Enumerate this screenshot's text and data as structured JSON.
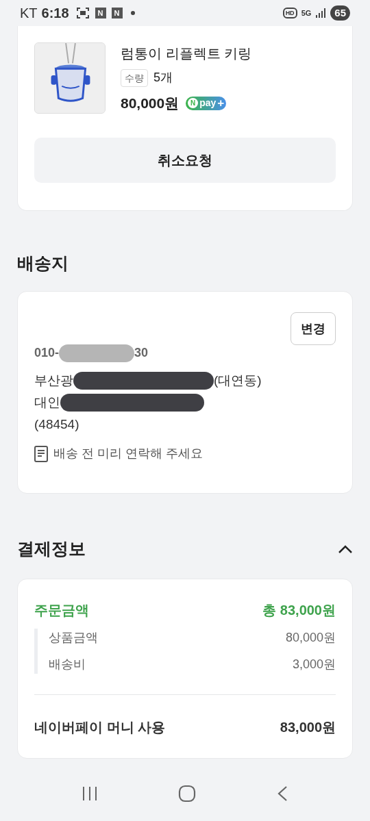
{
  "status_bar": {
    "carrier": "KT",
    "time": "6:18",
    "notification_letters": [
      "N",
      "N"
    ],
    "hd_badge": "HD",
    "network": "5G",
    "battery": "65"
  },
  "order_item": {
    "name": "럼통이 리플렉트 키링",
    "quantity_label": "수량",
    "quantity": "5개",
    "price": "80,000원",
    "pay_badge": {
      "logo": "N",
      "text": "pay",
      "plus": "+"
    },
    "cancel_button": "취소요청"
  },
  "shipping": {
    "title": "배송지",
    "change_button": "변경",
    "phone_parts": [
      "010-",
      "30"
    ],
    "address_lines": [
      {
        "text": "부산광",
        "redacted": true,
        "after": "(대연동)"
      },
      {
        "text": "대인",
        "redacted": true
      },
      {
        "text": "(48454)",
        "redacted": false
      }
    ],
    "memo": "배송 전 미리 연락해 주세요"
  },
  "payment": {
    "title": "결제정보",
    "expanded": true,
    "order_label": "주문금액",
    "order_total": "총 83,000원",
    "breakdown": [
      {
        "label": "상품금액",
        "value": "80,000원"
      },
      {
        "label": "배송비",
        "value": "3,000원"
      }
    ],
    "method_label": "네이버페이 머니 사용",
    "method_amount": "83,000원"
  }
}
